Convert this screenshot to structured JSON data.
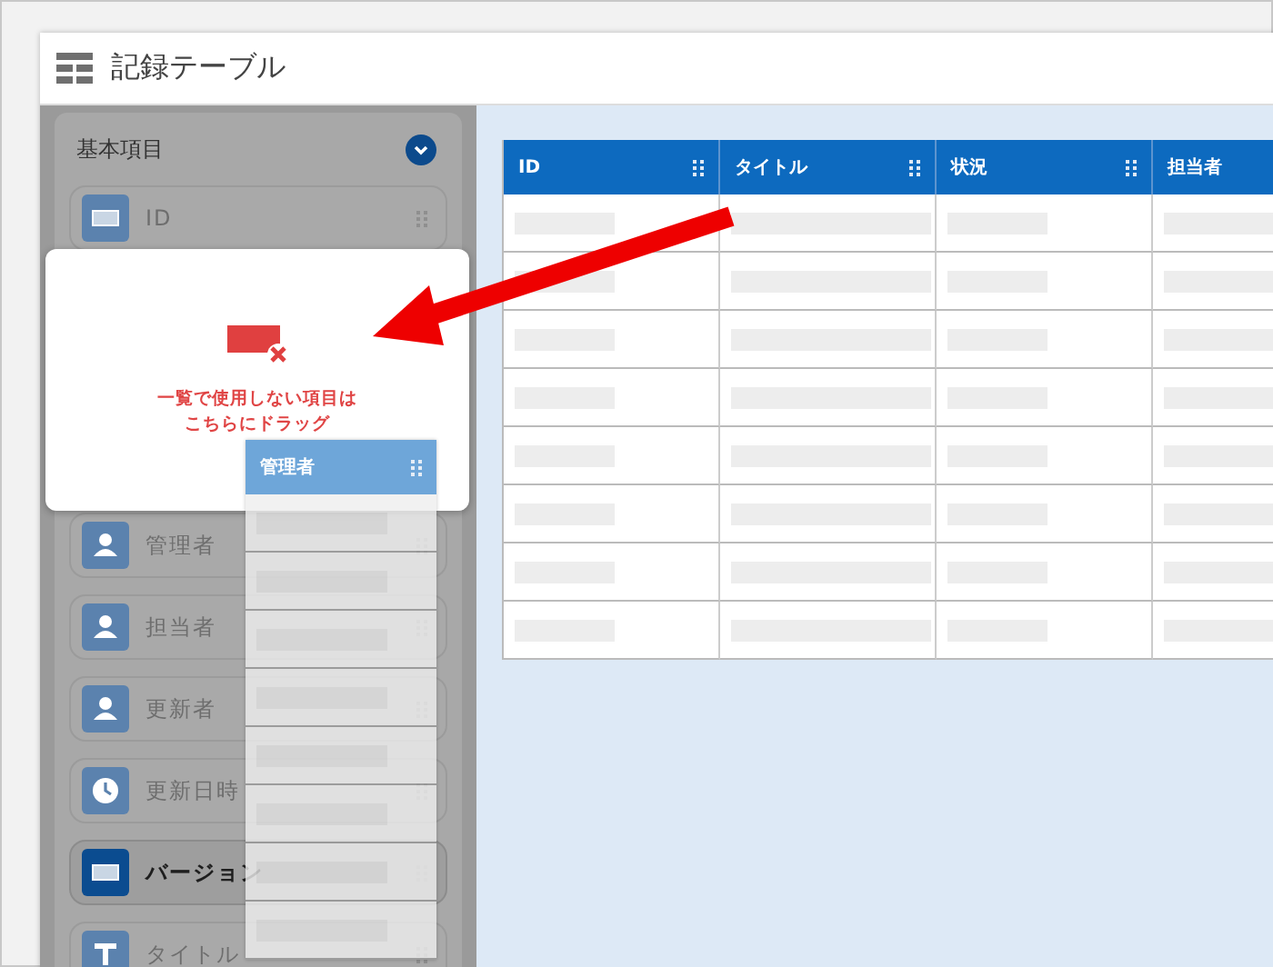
{
  "window": {
    "title": "記録テーブル"
  },
  "sidebar": {
    "section": {
      "title": "基本項目",
      "expanded": true
    },
    "fields": [
      {
        "label": "ID",
        "kind": "number",
        "highlighted": false
      },
      {
        "label": "管理者",
        "kind": "user",
        "highlighted": false
      },
      {
        "label": "担当者",
        "kind": "user",
        "highlighted": false
      },
      {
        "label": "更新者",
        "kind": "user",
        "highlighted": false
      },
      {
        "label": "更新日時",
        "kind": "clock",
        "highlighted": false
      },
      {
        "label": "バージョン",
        "kind": "number",
        "highlighted": true
      },
      {
        "label": "タイトル",
        "kind": "text",
        "highlighted": false
      }
    ]
  },
  "drop_zone": {
    "lines": [
      "一覧で使用しない項目は",
      "こちらにドラッグ"
    ]
  },
  "dragged_column": {
    "label": "管理者"
  },
  "table": {
    "columns": [
      "ID",
      "タイトル",
      "状況",
      "担当者"
    ]
  }
}
